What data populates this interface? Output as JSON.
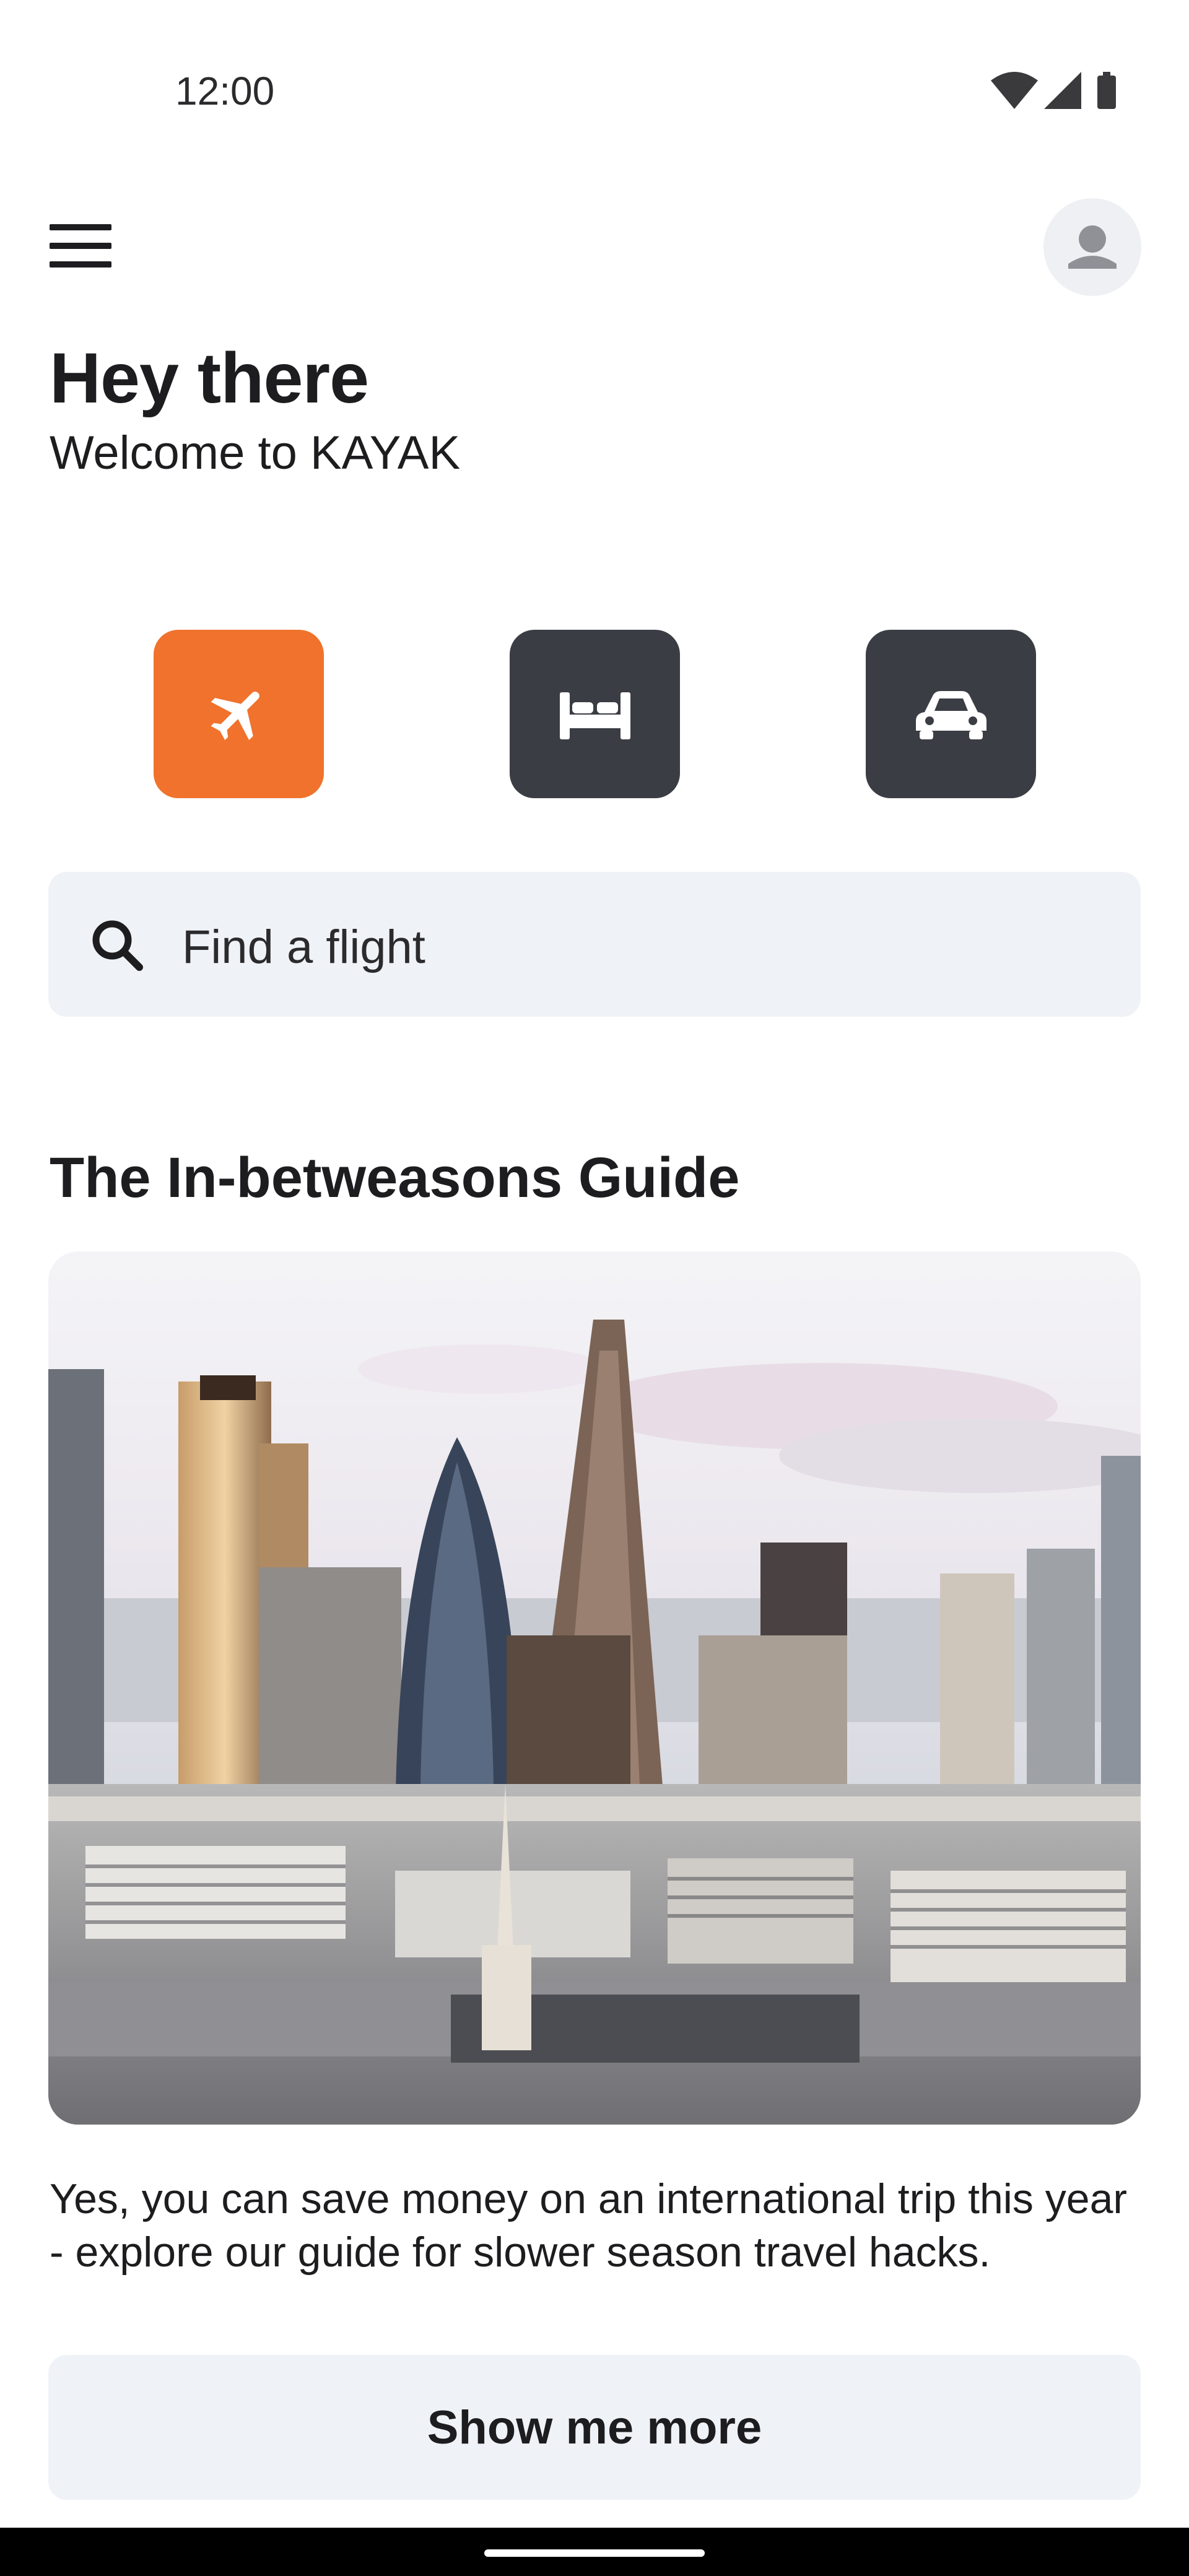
{
  "status_bar": {
    "time": "12:00",
    "icons": [
      "wifi-icon",
      "cell-signal-icon",
      "battery-icon"
    ]
  },
  "header": {
    "menu_icon": "hamburger-menu-icon",
    "avatar_icon": "user-avatar-icon"
  },
  "greeting": {
    "title": "Hey there",
    "subtitle": "Welcome to KAYAK"
  },
  "verticals": [
    {
      "id": "flights",
      "icon": "airplane-icon",
      "selected": true
    },
    {
      "id": "stays",
      "icon": "bed-icon",
      "selected": false
    },
    {
      "id": "cars",
      "icon": "car-icon",
      "selected": false
    }
  ],
  "search": {
    "placeholder": "Find a flight",
    "icon": "search-icon"
  },
  "guide": {
    "title": "The In-betweasons Guide",
    "description": "Yes, you can save money on an international trip this year - explore our guide for slower season travel hacks.",
    "button_label": "Show me more"
  },
  "colors": {
    "accent": "#f0722c",
    "tile_dark": "#3a3d43",
    "surface": "#eff2f6",
    "text": "#1d1d20"
  }
}
